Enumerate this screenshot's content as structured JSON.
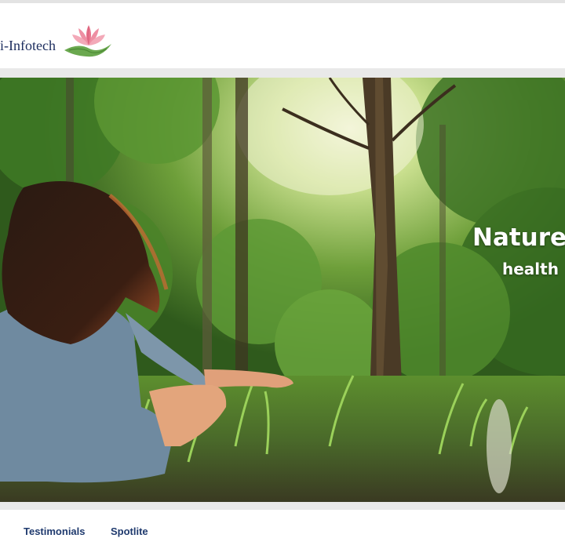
{
  "header": {
    "brand_text": "i-Infotech",
    "logo_icon": "lotus-logo-icon"
  },
  "hero": {
    "headline": "Nature",
    "subline": "health",
    "image": "woman-meditating-in-forest-photo"
  },
  "nav": {
    "items": [
      {
        "label": "Testimonials"
      },
      {
        "label": "Spotlite"
      }
    ]
  },
  "colors": {
    "nav_text": "#1f3a6e",
    "brand_text": "#1c2d5e",
    "separator": "#e9e9e9"
  }
}
